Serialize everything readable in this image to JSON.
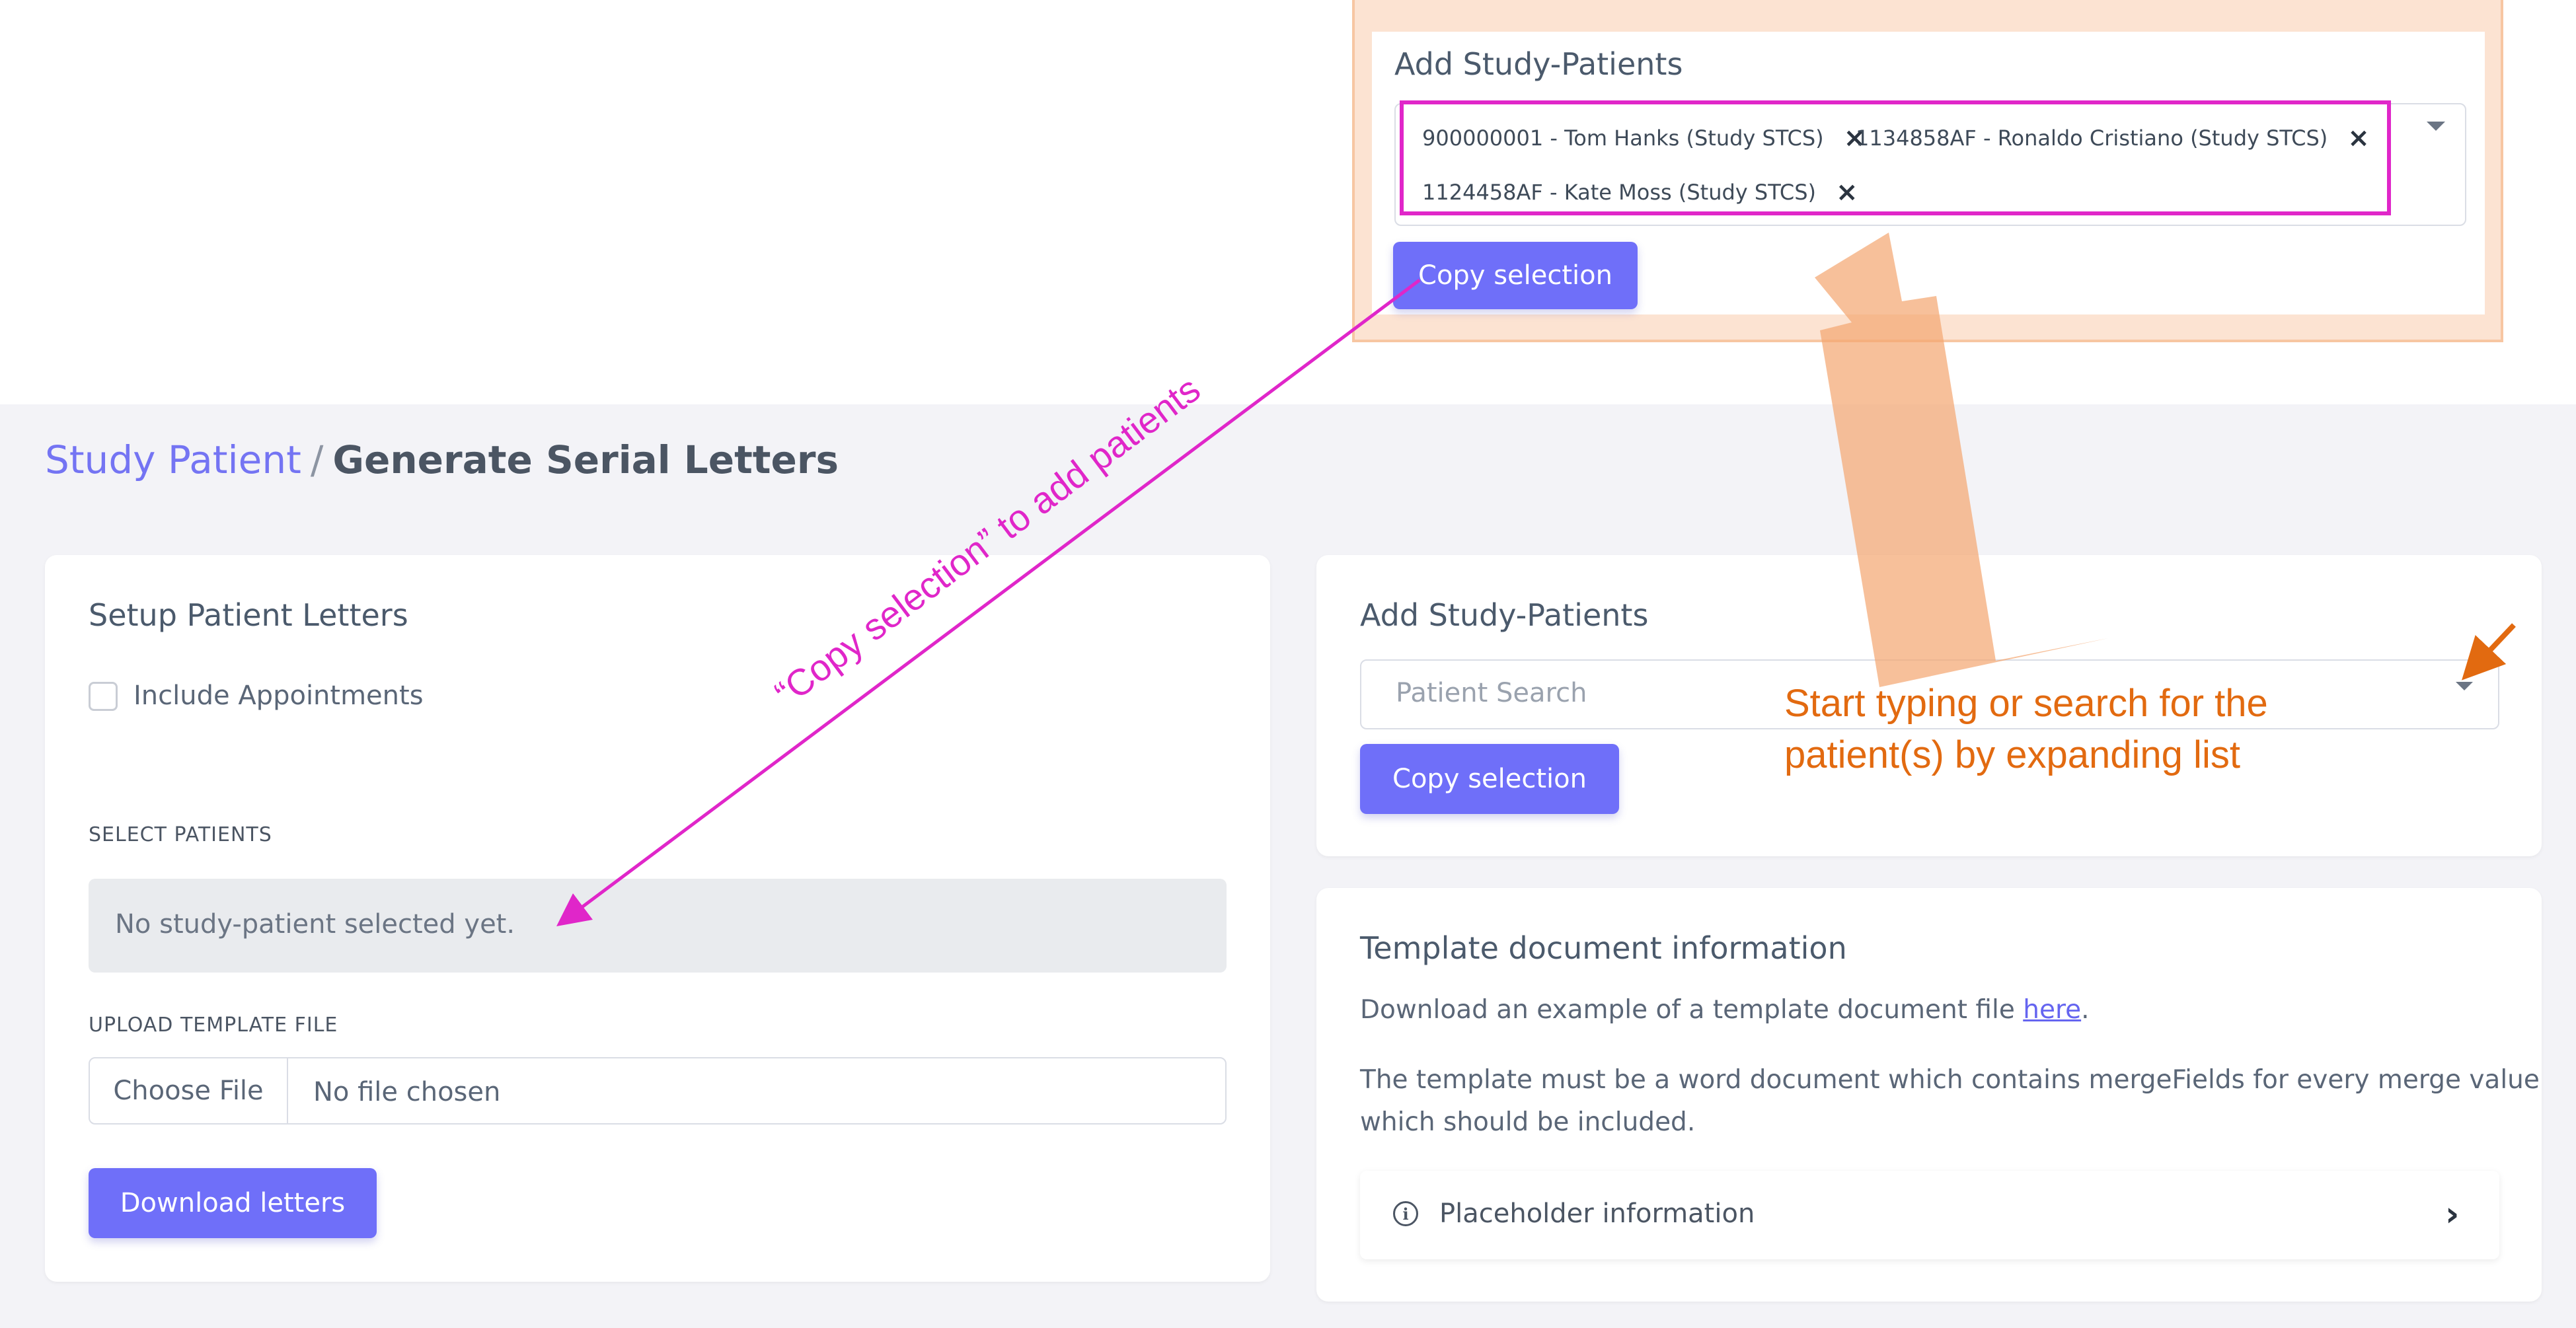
{
  "inset": {
    "title": "Add Study-Patients",
    "tags": [
      "900000001 - Tom Hanks (Study STCS)",
      "1134858AF - Ronaldo Cristiano (Study STCS)",
      "1124458AF - Kate Moss (Study STCS)"
    ],
    "remove_glyph": "×",
    "copy_button": "Copy selection"
  },
  "breadcrumb": {
    "parent": "Study Patient",
    "separator": "/",
    "current": "Generate Serial Letters"
  },
  "setup_card": {
    "title": "Setup Patient Letters",
    "include_appointments_label": "Include Appointments",
    "select_patients_label": "SELECT PATIENTS",
    "empty_message": "No study-patient selected yet.",
    "upload_label": "UPLOAD TEMPLATE FILE",
    "choose_file": "Choose File",
    "file_status": "No file chosen",
    "download_button": "Download letters"
  },
  "add_card": {
    "title": "Add Study-Patients",
    "search_placeholder": "Patient Search",
    "copy_button": "Copy selection"
  },
  "template_card": {
    "title": "Template document information",
    "download_text_prefix": "Download an example of a template document file ",
    "download_link": "here",
    "download_text_suffix": ".",
    "desc_line1": "The template must be a word document which contains mergeFields for every merge value",
    "desc_line2": "which should be included.",
    "placeholder_info": "Placeholder information",
    "info_glyph": "i",
    "chevron_glyph": "›"
  },
  "annotations": {
    "copy_hint": "“Copy selection” to add patients",
    "start_line1": "Start typing or search for the",
    "start_line2": "patient(s) by expanding list"
  },
  "colors": {
    "accent": "#6f6ff9",
    "annotation_magenta": "#e026c9",
    "annotation_orange": "#e26a10",
    "highlight_frame": "#fce3d2"
  }
}
